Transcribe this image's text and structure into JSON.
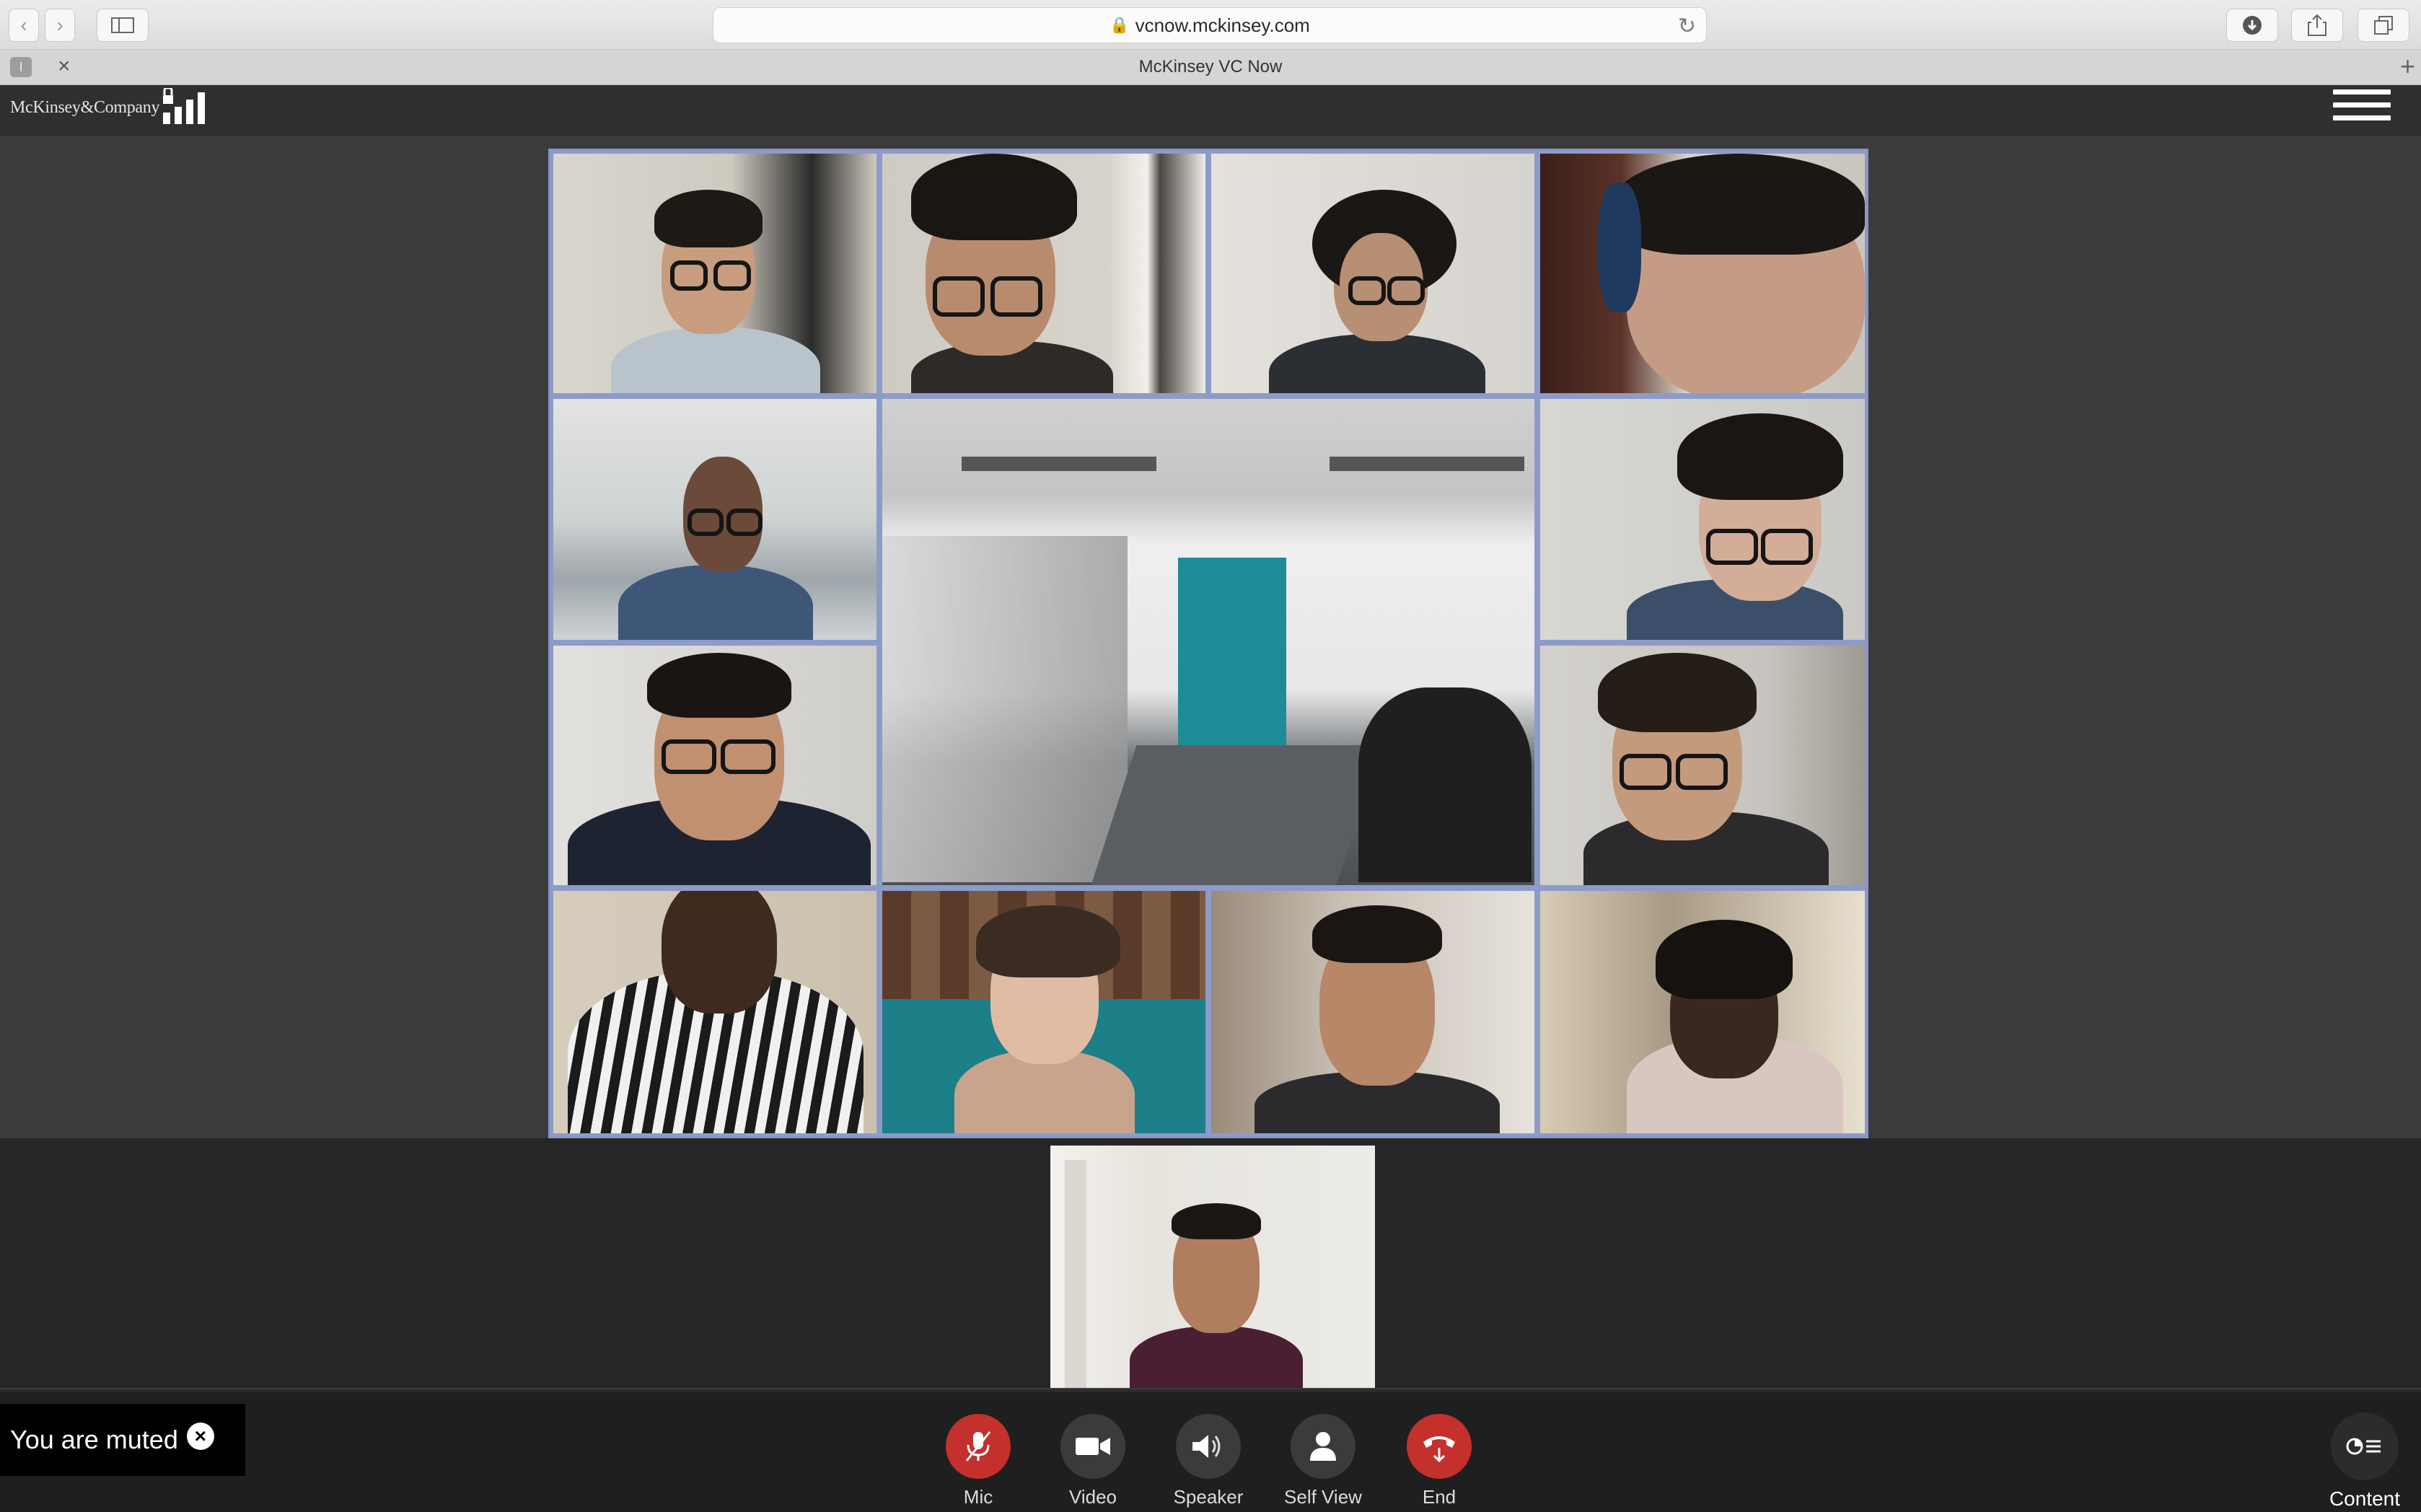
{
  "browser": {
    "url": "vcnow.mckinsey.com",
    "tab_title": "McKinsey VC Now"
  },
  "header": {
    "brand": "McKinsey&Company"
  },
  "notification": {
    "text": "You are muted"
  },
  "controls": [
    {
      "id": "mic",
      "label": "Mic",
      "icon": "mic-muted-icon",
      "active_color": "#c4302b"
    },
    {
      "id": "video",
      "label": "Video",
      "icon": "video-camera-icon"
    },
    {
      "id": "speaker",
      "label": "Speaker",
      "icon": "speaker-icon"
    },
    {
      "id": "self_view",
      "label": "Self View",
      "icon": "person-icon"
    },
    {
      "id": "end",
      "label": "End",
      "icon": "hang-up-icon",
      "active_color": "#c4302b"
    }
  ],
  "content_button": {
    "label": "Content",
    "icon": "content-share-icon"
  },
  "colors": {
    "grid_border": "#8896c6",
    "app_bar": "#2f2f2f",
    "control_bar": "#1f1f1f",
    "alert_red": "#c4302b"
  }
}
